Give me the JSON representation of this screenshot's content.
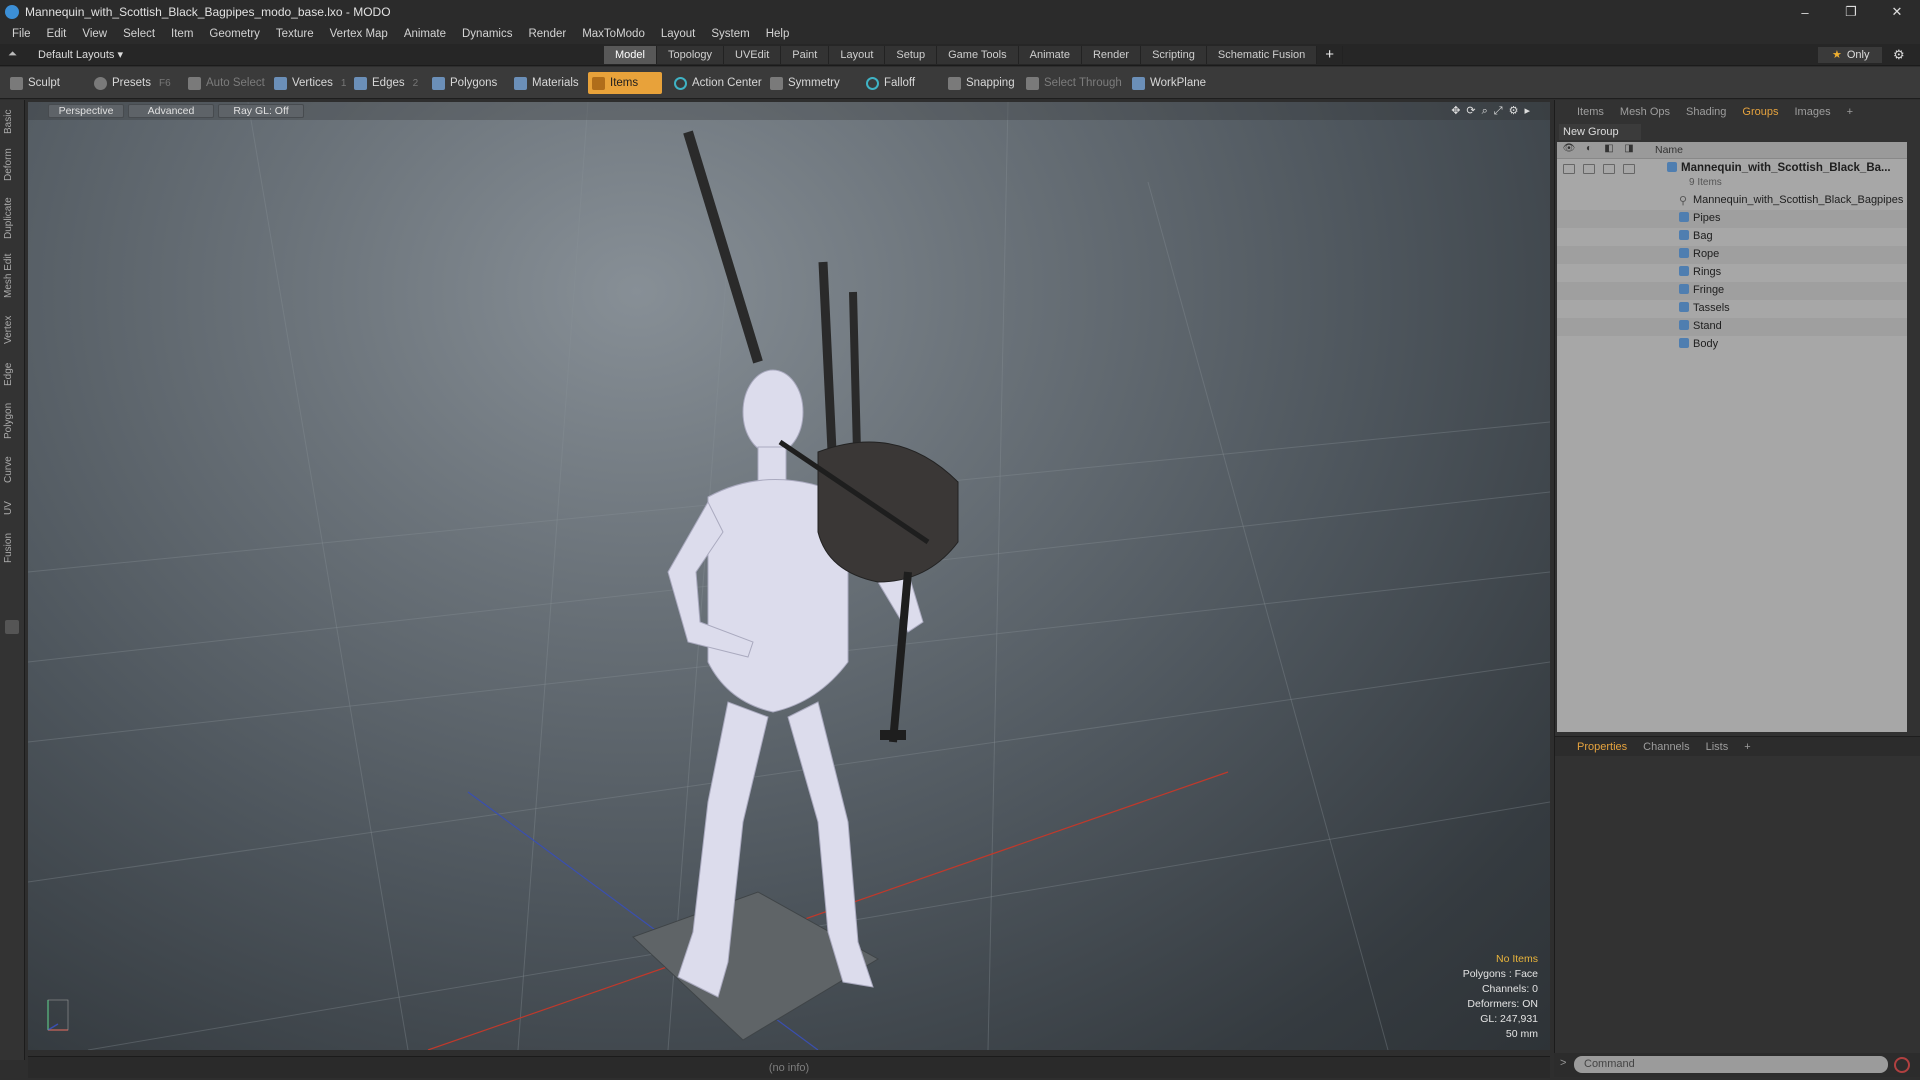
{
  "window": {
    "title": "Mannequin_with_Scottish_Black_Bagpipes_modo_base.lxo - MODO",
    "controls": [
      "–",
      "❐",
      "✕"
    ]
  },
  "menu": [
    "File",
    "Edit",
    "View",
    "Select",
    "Item",
    "Geometry",
    "Texture",
    "Vertex Map",
    "Animate",
    "Dynamics",
    "Render",
    "MaxToModo",
    "Layout",
    "System",
    "Help"
  ],
  "layout": {
    "dropdown": "Default Layouts ▾",
    "tabs": [
      "Model",
      "Topology",
      "UVEdit",
      "Paint",
      "Layout",
      "Setup",
      "Game Tools",
      "Animate",
      "Render",
      "Scripting",
      "Schematic Fusion"
    ],
    "active_tab": "Model",
    "only_label": "Only",
    "plus": "+",
    "gear": "⚙"
  },
  "toolbar": {
    "sculpt": "Sculpt",
    "presets": "Presets",
    "presets_key": "F6",
    "auto_select": "Auto Select",
    "vertices": "Vertices",
    "vertices_key": "1",
    "edges": "Edges",
    "edges_key": "2",
    "polygons": "Polygons",
    "materials": "Materials",
    "items": "Items",
    "action_center": "Action Center",
    "symmetry": "Symmetry",
    "falloff": "Falloff",
    "snapping": "Snapping",
    "select_through": "Select Through",
    "workplane": "WorkPlane"
  },
  "left_tabs": [
    "Basic",
    "Deform",
    "Duplicate",
    "Mesh Edit",
    "Vertex",
    "Edge",
    "Polygon",
    "Curve",
    "UV",
    "Fusion"
  ],
  "viewport": {
    "view": "Perspective",
    "shading": "Advanced",
    "raygl": "Ray GL: Off",
    "hud": {
      "selection": "No Items",
      "polygons": "Polygons : Face",
      "channels": "Channels: 0",
      "deformers": "Deformers: ON",
      "gl": "GL: 247,931",
      "focal": "50 mm"
    }
  },
  "right_panel": {
    "tabs": [
      "Items",
      "Mesh Ops",
      "Shading",
      "Groups",
      "Images",
      "+"
    ],
    "active_tab": "Groups",
    "new_group": "New Group",
    "name_col": "Name",
    "root": {
      "label": "Mannequin_with_Scottish_Black_Ba...",
      "count": "9 Items"
    },
    "items": [
      "Mannequin_with_Scottish_Black_Bagpipes",
      "Pipes",
      "Bag",
      "Rope",
      "Rings",
      "Fringe",
      "Tassels",
      "Stand",
      "Body"
    ]
  },
  "properties": {
    "tabs": [
      "Properties",
      "Channels",
      "Lists",
      "+"
    ],
    "active_tab": "Properties"
  },
  "command": {
    "placeholder": "Command",
    "prompt": ">"
  },
  "status": {
    "info": "(no info)"
  },
  "colors": {
    "accent": "#e8a23a",
    "items_button": "#e8a23a"
  }
}
